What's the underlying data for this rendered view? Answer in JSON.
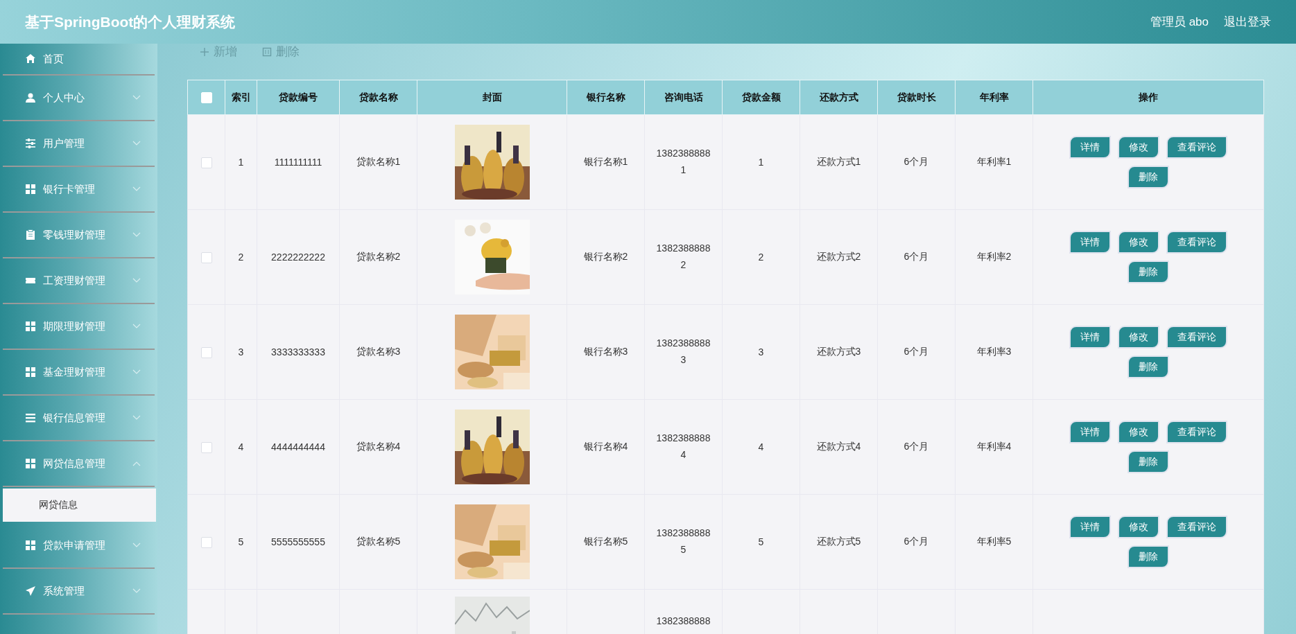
{
  "header": {
    "title": "基于SpringBoot的个人理财系统",
    "user": "管理员 abo",
    "logout": "退出登录"
  },
  "sidebar": {
    "items": [
      {
        "label": "首页"
      },
      {
        "label": "个人中心",
        "expanded": false
      },
      {
        "label": "用户管理",
        "expanded": false
      },
      {
        "label": "银行卡管理",
        "expanded": false
      },
      {
        "label": "零钱理财管理",
        "expanded": false
      },
      {
        "label": "工资理财管理",
        "expanded": false
      },
      {
        "label": "期限理财管理",
        "expanded": false
      },
      {
        "label": "基金理财管理",
        "expanded": false
      },
      {
        "label": "银行信息管理",
        "expanded": false
      },
      {
        "label": "网贷信息管理",
        "expanded": true,
        "children": [
          {
            "label": "网贷信息",
            "selected": true
          }
        ]
      },
      {
        "label": "贷款申请管理",
        "expanded": false
      },
      {
        "label": "系统管理",
        "expanded": false
      }
    ]
  },
  "toolbar": [
    {
      "label": "新增"
    },
    {
      "label": "删除"
    }
  ],
  "table": {
    "select_all_checked": false,
    "columns": [
      "索引",
      "贷款编号",
      "贷款名称",
      "封面",
      "银行名称",
      "咨询电话",
      "贷款金额",
      "还款方式",
      "贷款时长",
      "年利率",
      "操作"
    ],
    "rows": [
      {
        "checked": false,
        "index": "1",
        "loan_no": "1111111111",
        "loan_name": "贷款名称1",
        "bank": "银行名称1",
        "phone": "13823888881",
        "amount": "1",
        "repayment": "还款方式1",
        "duration": "6个月",
        "rate": "年利率1",
        "actions": [
          "详情",
          "修改",
          "查看评论",
          "删除"
        ]
      },
      {
        "checked": false,
        "index": "2",
        "loan_no": "2222222222",
        "loan_name": "贷款名称2",
        "bank": "银行名称2",
        "phone": "13823888882",
        "amount": "2",
        "repayment": "还款方式2",
        "duration": "6个月",
        "rate": "年利率2",
        "actions": [
          "详情",
          "修改",
          "查看评论",
          "删除"
        ]
      },
      {
        "checked": false,
        "index": "3",
        "loan_no": "3333333333",
        "loan_name": "贷款名称3",
        "bank": "银行名称3",
        "phone": "13823888883",
        "amount": "3",
        "repayment": "还款方式3",
        "duration": "6个月",
        "rate": "年利率3",
        "actions": [
          "详情",
          "修改",
          "查看评论",
          "删除"
        ]
      },
      {
        "checked": false,
        "index": "4",
        "loan_no": "4444444444",
        "loan_name": "贷款名称4",
        "bank": "银行名称4",
        "phone": "13823888884",
        "amount": "4",
        "repayment": "还款方式4",
        "duration": "6个月",
        "rate": "年利率4",
        "actions": [
          "详情",
          "修改",
          "查看评论",
          "删除"
        ]
      },
      {
        "checked": false,
        "index": "5",
        "loan_no": "5555555555",
        "loan_name": "贷款名称5",
        "bank": "银行名称5",
        "phone": "13823888885",
        "amount": "5",
        "repayment": "还款方式5",
        "duration": "6个月",
        "rate": "年利率5",
        "actions": [
          "详情",
          "修改",
          "查看评论",
          "删除"
        ]
      },
      {
        "phone": "1382388888"
      }
    ]
  }
}
